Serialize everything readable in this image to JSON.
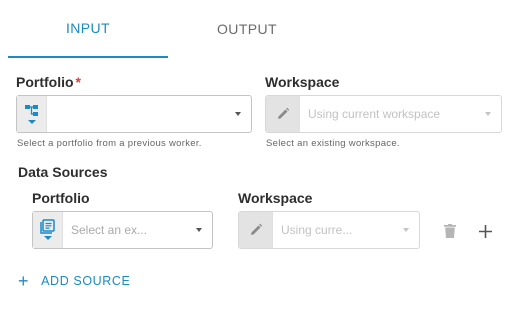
{
  "tabs": [
    {
      "label": "INPUT",
      "active": true
    },
    {
      "label": "OUTPUT",
      "active": false
    }
  ],
  "portfolio": {
    "label": "Portfolio",
    "required_mark": "*",
    "value": "",
    "helper": "Select a portfolio from a previous worker.",
    "icon": "hierarchy-icon"
  },
  "workspace": {
    "label": "Workspace",
    "placeholder": "Using current workspace",
    "helper": "Select an existing workspace.",
    "icon": "pencil-icon",
    "disabled": true
  },
  "data_sources": {
    "title": "Data Sources",
    "rows": [
      {
        "portfolio_label": "Portfolio",
        "portfolio_placeholder": "Select an ex...",
        "portfolio_icon": "list-icon",
        "workspace_label": "Workspace",
        "workspace_placeholder": "Using curre...",
        "workspace_icon": "pencil-icon"
      }
    ],
    "add_label": "ADD SOURCE"
  },
  "colors": {
    "accent": "#1a8ac8",
    "required": "#e53935"
  }
}
